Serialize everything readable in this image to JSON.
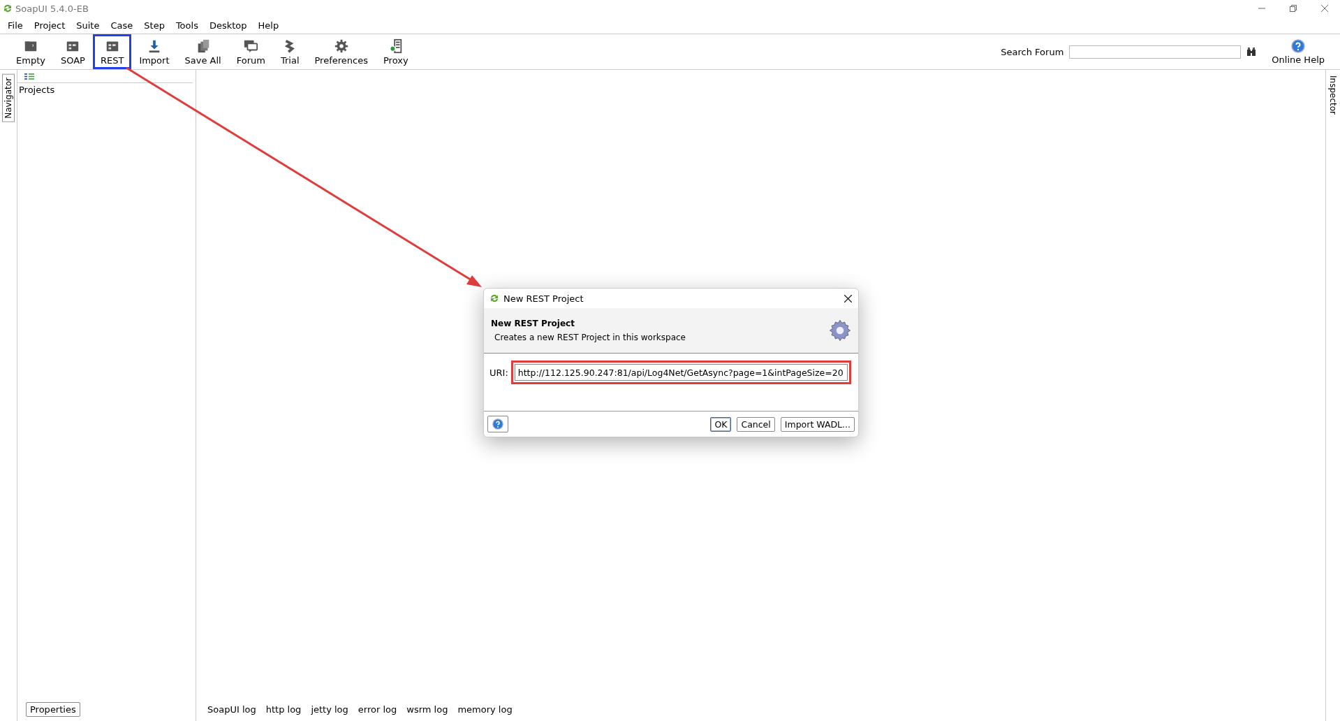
{
  "window": {
    "title": "SoapUI 5.4.0-EB"
  },
  "menu": [
    "File",
    "Project",
    "Suite",
    "Case",
    "Step",
    "Tools",
    "Desktop",
    "Help"
  ],
  "toolbar": [
    {
      "label": "Empty",
      "highlighted": false
    },
    {
      "label": "SOAP",
      "highlighted": false
    },
    {
      "label": "REST",
      "highlighted": true
    },
    {
      "label": "Import",
      "highlighted": false
    },
    {
      "label": "Save All",
      "highlighted": false
    },
    {
      "label": "Forum",
      "highlighted": false
    },
    {
      "label": "Trial",
      "highlighted": false
    },
    {
      "label": "Preferences",
      "highlighted": false
    },
    {
      "label": "Proxy",
      "highlighted": false
    }
  ],
  "search": {
    "label": "Search Forum"
  },
  "help": {
    "label": "Online Help"
  },
  "navigator": {
    "tab": "Navigator",
    "tree_root": "Projects",
    "properties_button": "Properties"
  },
  "inspector": {
    "tab": "Inspector"
  },
  "log_tabs": [
    "SoapUI log",
    "http log",
    "jetty log",
    "error log",
    "wsrm log",
    "memory log"
  ],
  "dialog": {
    "title": "New REST Project",
    "heading": "New REST Project",
    "description": "Creates a new REST Project in this workspace",
    "uri_label": "URI:",
    "uri_value": "http://112.125.90.247:81/api/Log4Net/GetAsync?page=1&intPageSize=20",
    "uri_highlighted": true,
    "buttons": [
      "OK",
      "Cancel",
      "Import WADL..."
    ]
  }
}
